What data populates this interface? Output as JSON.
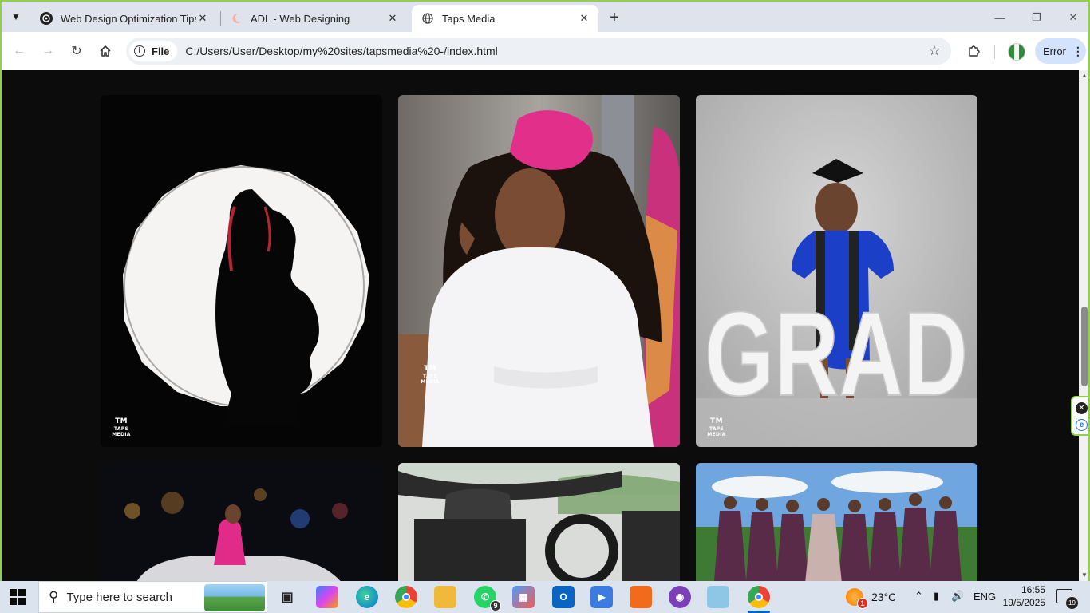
{
  "browser": {
    "tabs": [
      {
        "title": "Web Design Optimization Tips",
        "active": false
      },
      {
        "title": "ADL - Web Designing",
        "active": false
      },
      {
        "title": "Taps Media",
        "active": true
      }
    ],
    "new_tab_label": "+",
    "address": {
      "scheme_chip": "File",
      "url": "C:/Users/User/Desktop/my%20sites/tapsmedia%20-/index.html"
    },
    "profile_button": "Error"
  },
  "gallery": {
    "watermark": "TAPS MEDIA",
    "watermark_logo": "TM",
    "photos": [
      {
        "subject": "maternity-silhouette"
      },
      {
        "subject": "woman-white-dress-pink-fascinator"
      },
      {
        "subject": "graduate-with-grad-letters",
        "letters": "GRAD"
      },
      {
        "subject": "woman-on-car-night"
      },
      {
        "subject": "convertible-car-interior"
      },
      {
        "subject": "bridesmaids-group"
      }
    ]
  },
  "taskbar": {
    "search_placeholder": "Type here to search",
    "whatsapp_badge": "9",
    "weather": "23°C",
    "weather_badge": "1",
    "language": "ENG",
    "time": "16:55",
    "date": "19/5/2025",
    "notification_count": "19"
  },
  "colors": {
    "window_border": "#8fd14f",
    "page_background": "#0c0c0c",
    "profile_button": "#d3e3fd"
  }
}
